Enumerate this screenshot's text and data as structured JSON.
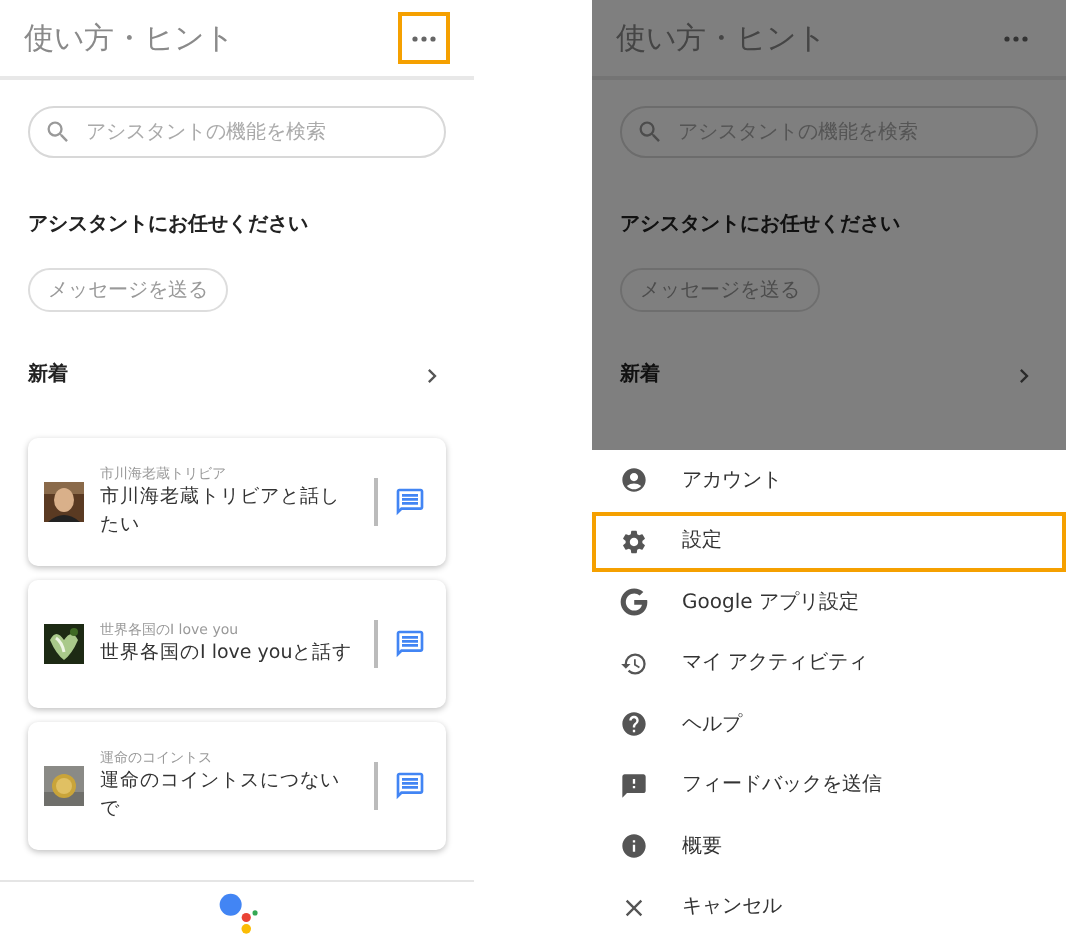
{
  "screens": [
    {
      "dimmed": false,
      "header": {
        "title": "使い方・ヒント",
        "more_highlighted": true
      },
      "search": {
        "placeholder": "アシスタントの機能を検索"
      },
      "section_title": "アシスタントにお任せください",
      "chip": "メッセージを送る",
      "new_heading": "新着",
      "cards": [
        {
          "caption": "市川海老蔵トリビア",
          "text": "市川海老蔵トリビアと話したい"
        },
        {
          "caption": "世界各国のI love you",
          "text": "世界各国のI love youと話す"
        },
        {
          "caption": "運命のコイントス",
          "text": "運命のコイントスにつないで"
        }
      ]
    },
    {
      "dimmed": true,
      "header": {
        "title": "使い方・ヒント",
        "more_highlighted": false
      },
      "search": {
        "placeholder": "アシスタントの機能を検索"
      },
      "section_title": "アシスタントにお任せください",
      "chip": "メッセージを送る",
      "new_heading": "新着",
      "menu": [
        {
          "label": "アカウント",
          "highlighted": false
        },
        {
          "label": "設定",
          "highlighted": true
        },
        {
          "label": "Google アプリ設定",
          "highlighted": false
        },
        {
          "label": "マイ アクティビティ",
          "highlighted": false
        },
        {
          "label": "ヘルプ",
          "highlighted": false
        },
        {
          "label": "フィードバックを送信",
          "highlighted": false
        },
        {
          "label": "概要",
          "highlighted": false
        },
        {
          "label": "キャンセル",
          "highlighted": false
        }
      ]
    }
  ]
}
